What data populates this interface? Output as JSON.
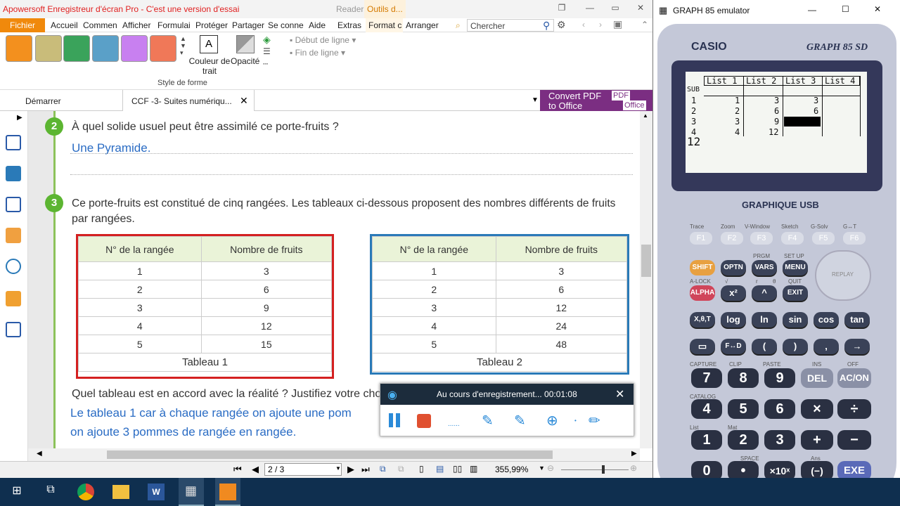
{
  "pdf_app": {
    "title": "Apowersoft Enregistreur d'écran Pro - C'est une version d'essai",
    "reader_label": "Reader",
    "outils_label": "Outils d...",
    "ribbon_tabs": [
      "Fichier",
      "Accueil",
      "Commen",
      "Afficher",
      "Formulai",
      "Protéger",
      "Partager",
      "Se conne",
      "Aide",
      "Extras",
      "Format c",
      "Arranger"
    ],
    "search_placeholder": "Chercher",
    "ribbon": {
      "swatch_colors": [
        "#f3901e",
        "#c9bc7a",
        "#3aa35b",
        "#5aa0c8",
        "#c880f0",
        "#f07858"
      ],
      "couleur_trait": "Couleur de trait",
      "opacite": "Opacité",
      "debut_ligne": "Début de ligne",
      "fin_ligne": "Fin de ligne",
      "style_forme": "Style de forme"
    },
    "doc_tabs": {
      "start": "Démarrer",
      "active": "CCF -3- Suites numériqu..."
    },
    "convert": {
      "line1": "Convert PDF",
      "line2": "to Office",
      "badge1": "PDF",
      "badge2": "Office"
    },
    "content": {
      "q2_num": "2",
      "q2_text": "À quel solide usuel peut être assimilé ce porte-fruits ?",
      "q2_answer": "Une Pyramide.",
      "q3_num": "3",
      "q3_text_line1": "Ce porte-fruits est constitué de cinq rangées. Les tableaux ci-dessous proposent des nombres différents de fruits",
      "q3_text_line2": "par rangées.",
      "table_headers": [
        "N° de la rangée",
        "Nombre de fruits"
      ],
      "table1": {
        "rows": [
          [
            "1",
            "3"
          ],
          [
            "2",
            "6"
          ],
          [
            "3",
            "9"
          ],
          [
            "4",
            "12"
          ],
          [
            "5",
            "15"
          ]
        ],
        "caption": "Tableau 1"
      },
      "table2": {
        "rows": [
          [
            "1",
            "3"
          ],
          [
            "2",
            "6"
          ],
          [
            "3",
            "12"
          ],
          [
            "4",
            "24"
          ],
          [
            "5",
            "48"
          ]
        ],
        "caption": "Tableau 2"
      },
      "q_reality": "Quel tableau est en accord avec la réalité ? Justifiez votre choi",
      "answer_line1": "Le tableau 1 car à chaque rangée on ajoute une pom",
      "answer_line2": "on ajoute 3 pommes de rangée en rangée."
    },
    "status": {
      "page": "2 / 3",
      "zoom": "355,99%"
    }
  },
  "recorder": {
    "status": "Au cours d'enregistrement... 00:01:08",
    "dots": "......"
  },
  "emulator": {
    "title": "GRAPH 85 emulator",
    "brand": "CASIO",
    "model": "GRAPH 85 SD",
    "graphique": "GRAPHIQUE USB",
    "lcd": {
      "headers": [
        "List 1",
        "List 2",
        "List 3",
        "List 4"
      ],
      "sub": "SUB",
      "rows": [
        [
          "1",
          "1",
          "3",
          "3"
        ],
        [
          "2",
          "2",
          "6",
          "6"
        ],
        [
          "3",
          "3",
          "9",
          ""
        ],
        [
          "4",
          "4",
          "12",
          ""
        ]
      ],
      "input": "12"
    },
    "fkeys": [
      "F1",
      "F2",
      "F3",
      "F4",
      "F5",
      "F6"
    ],
    "fkey_labels": [
      "Trace",
      "Zoom",
      "V-Window",
      "Sketch",
      "G-Solv",
      "G↔T"
    ],
    "row1": [
      "SHIFT",
      "OPTN",
      "VARS",
      "MENU"
    ],
    "row1_labels": [
      "PRGM",
      "SET UP"
    ],
    "row2": [
      "ALPHA",
      "x²",
      "^",
      "EXIT"
    ],
    "row2_labels": [
      "A-LOCK",
      "√",
      "r",
      "θ",
      "QUIT"
    ],
    "replay": "REPLAY",
    "row3": [
      "X,θ,T",
      "log",
      "ln",
      "sin",
      "cos",
      "tan"
    ],
    "row4": [
      "▭",
      "F↔D",
      "(",
      ")",
      ",",
      "→"
    ],
    "num_rows": [
      [
        "7",
        "8",
        "9",
        "DEL",
        "AC/ON"
      ],
      [
        "4",
        "5",
        "6",
        "×",
        "÷"
      ],
      [
        "1",
        "2",
        "3",
        "+",
        "−"
      ],
      [
        "0",
        "•",
        "×10ˣ",
        "(−)",
        "EXE"
      ]
    ],
    "num_labels": [
      "CAPTURE",
      "CLIP",
      "PASTE",
      "INS",
      "OFF",
      "CATALOG",
      "List",
      "Mat",
      "SPACE",
      "Ans"
    ]
  },
  "taskbar": {
    "items": [
      "windows-start",
      "task-view",
      "chrome",
      "file-explorer",
      "word",
      "calculator",
      "pdf-app"
    ]
  }
}
